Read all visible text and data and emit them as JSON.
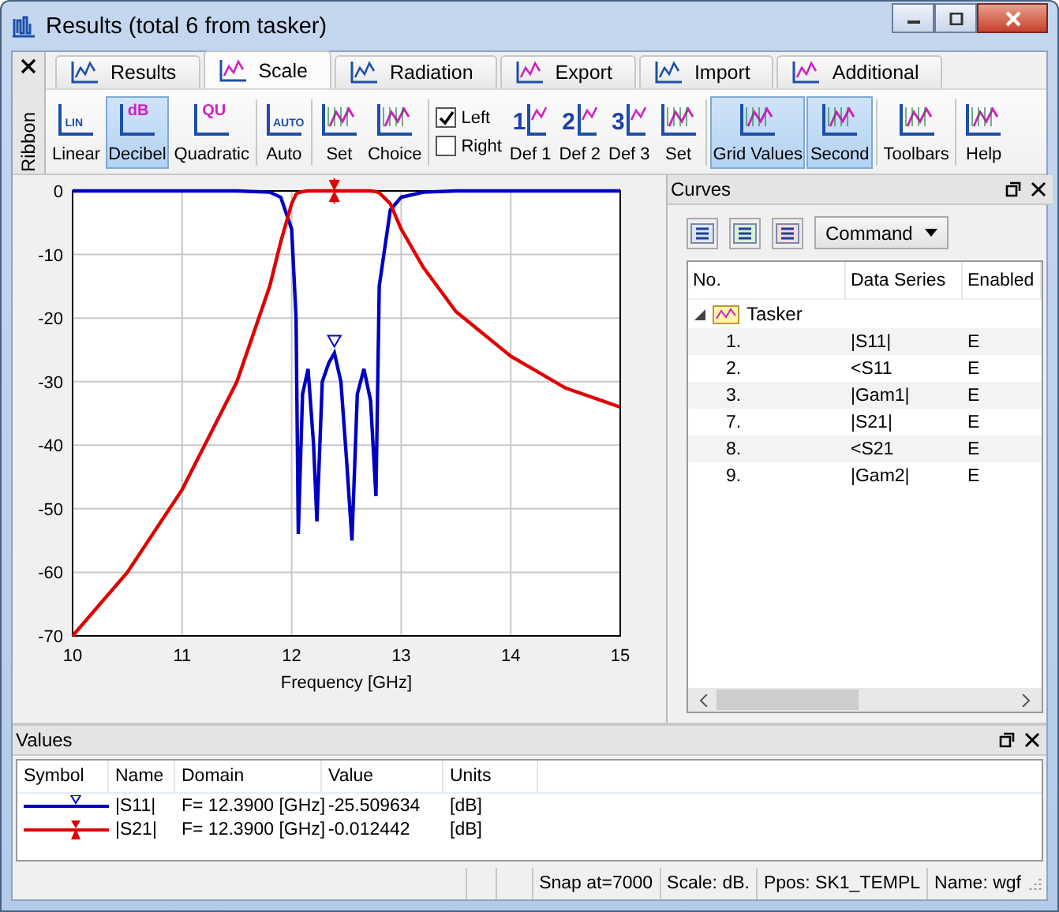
{
  "window": {
    "title": "Results (total 6 from tasker)"
  },
  "ribbon": {
    "label": "Ribbon",
    "tabs": [
      {
        "label": "Results",
        "selected": false
      },
      {
        "label": "Scale",
        "selected": true
      },
      {
        "label": "Radiation",
        "selected": false
      },
      {
        "label": "Export",
        "selected": false
      },
      {
        "label": "Import",
        "selected": false
      },
      {
        "label": "Additional",
        "selected": false
      }
    ],
    "groups": [
      {
        "items": [
          {
            "kind": "button",
            "label": "Linear",
            "icon_text": "LIN",
            "selected": false
          },
          {
            "kind": "button",
            "label": "Decibel",
            "icon_text": "dB",
            "selected": true
          },
          {
            "kind": "button",
            "label": "Quadratic",
            "icon_text": "QU",
            "selected": false
          }
        ]
      },
      {
        "items": [
          {
            "kind": "button",
            "label": "Auto",
            "icon_text": "AUTO",
            "selected": false
          }
        ]
      },
      {
        "items": [
          {
            "kind": "button",
            "label": "Set",
            "selected": false
          },
          {
            "kind": "button",
            "label": "Choice",
            "selected": false
          }
        ]
      },
      {
        "items": [
          {
            "kind": "checks",
            "checks": [
              {
                "label": "Left",
                "checked": true
              },
              {
                "label": "Right",
                "checked": false
              }
            ]
          },
          {
            "kind": "button",
            "label": "Def 1",
            "icon_text": "1",
            "selected": false
          },
          {
            "kind": "button",
            "label": "Def 2",
            "icon_text": "2",
            "selected": false
          },
          {
            "kind": "button",
            "label": "Def 3",
            "icon_text": "3",
            "selected": false
          },
          {
            "kind": "button",
            "label": "Set",
            "selected": false
          }
        ]
      },
      {
        "items": [
          {
            "kind": "button",
            "label": "Grid Values",
            "selected": true
          },
          {
            "kind": "button",
            "label": "Second",
            "selected": true
          }
        ]
      },
      {
        "items": [
          {
            "kind": "button",
            "label": "Toolbars",
            "selected": false
          }
        ]
      },
      {
        "items": [
          {
            "kind": "button",
            "label": "Help",
            "selected": false
          }
        ]
      }
    ]
  },
  "chart": {
    "chart_data": {
      "type": "line",
      "grid": true,
      "xlabel": "Frequency [GHz]",
      "xlim": [
        10,
        15
      ],
      "ylim": [
        -70,
        0
      ],
      "xticks": [
        10,
        11,
        12,
        13,
        14,
        15
      ],
      "yticks": [
        0,
        -10,
        -20,
        -30,
        -40,
        -50,
        -60,
        -70
      ],
      "x": [
        10,
        10.5,
        11,
        11.5,
        11.8,
        11.9,
        12.0,
        12.04,
        12.06,
        12.1,
        12.15,
        12.2,
        12.23,
        12.28,
        12.34,
        12.39,
        12.45,
        12.5,
        12.55,
        12.6,
        12.66,
        12.72,
        12.77,
        12.8,
        12.9,
        13.0,
        13.2,
        13.5,
        14,
        14.5,
        15
      ],
      "series": [
        {
          "color": "#0000c0",
          "values": [
            0,
            0,
            0,
            0,
            -0.2,
            -1,
            -6,
            -20,
            -54,
            -32,
            -28,
            -40,
            -52,
            -30,
            -27,
            -25.5,
            -30,
            -42,
            -55,
            -32,
            -28,
            -33,
            -48,
            -15,
            -3,
            -1,
            -0.2,
            0,
            0,
            0,
            0
          ]
        },
        {
          "color": "#e00000",
          "values": [
            -70,
            -60,
            -47,
            -30,
            -15,
            -8,
            -2,
            -0.5,
            -0.3,
            -0.1,
            0,
            0,
            0,
            0,
            0,
            0,
            0,
            0,
            0,
            0,
            0,
            0,
            -0.1,
            -0.3,
            -2,
            -6,
            -12,
            -19,
            -26,
            -31,
            -34
          ]
        }
      ]
    }
  },
  "curves": {
    "title": "Curves",
    "command": "Command",
    "columns": [
      "No.",
      "Data Series",
      "Enabled"
    ],
    "groups": [
      {
        "label": "Tasker",
        "expanded": true,
        "children": [
          {
            "no": "1.",
            "series": "|S11|",
            "enabled": "E"
          },
          {
            "no": "2.",
            "series": "<S11",
            "enabled": "E"
          },
          {
            "no": "3.",
            "series": "|Gam1|",
            "enabled": "E"
          },
          {
            "no": "7.",
            "series": "|S21|",
            "enabled": "E"
          },
          {
            "no": "8.",
            "series": "<S21",
            "enabled": "E"
          },
          {
            "no": "9.",
            "series": "|Gam2|",
            "enabled": "E"
          }
        ]
      }
    ]
  },
  "values": {
    "title": "Values",
    "columns": [
      "Symbol",
      "Name",
      "Domain",
      "Value",
      "Units"
    ],
    "rows": [
      {
        "color": "#0000c0",
        "kind": "triangle",
        "name": "|S11|",
        "domain": "F= 12.3900 [GHz]",
        "value": "-25.509634",
        "units": "[dB]"
      },
      {
        "color": "#e00000",
        "kind": "bar",
        "name": "|S21|",
        "domain": "F= 12.3900 [GHz]",
        "value": "-0.012442",
        "units": "[dB]"
      }
    ]
  },
  "status_bar": [
    "Snap at=7000",
    "Scale: dB.",
    "Ppos: SK1_TEMPL",
    "Name: wgf"
  ]
}
